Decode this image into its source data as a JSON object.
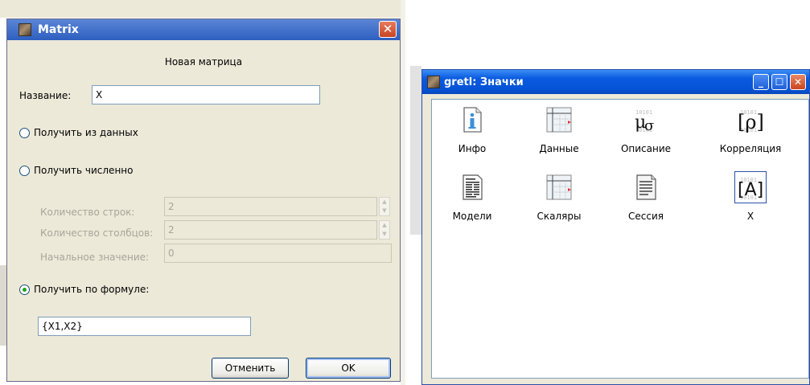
{
  "matrix_dialog": {
    "title": "Matrix",
    "heading": "Новая матрица",
    "name_label": "Название:",
    "name_value": "X",
    "from_data_label": "Получить из данных",
    "numeric_label": "Получить численно",
    "rows_label": "Количество строк:",
    "rows_value": "2",
    "cols_label": "Количество столбцов:",
    "cols_value": "2",
    "init_label": "Начальное значение:",
    "init_value": "0",
    "formula_label": "Получить по формуле:",
    "formula_value": "{X1,X2}",
    "cancel_label": "Отменить",
    "ok_label": "OK",
    "selected_option": "formula"
  },
  "icons_window": {
    "title": "gretl: Значки",
    "items": [
      {
        "label": "Инфо",
        "icon": "info-icon"
      },
      {
        "label": "Данные",
        "icon": "data-table-icon"
      },
      {
        "label": "Описание",
        "icon": "summary-stats-icon"
      },
      {
        "label": "Корреляция",
        "icon": "correlation-icon"
      },
      {
        "label": "Модели",
        "icon": "models-icon"
      },
      {
        "label": "Скаляры",
        "icon": "scalars-table-icon"
      },
      {
        "label": "Сессия",
        "icon": "session-notes-icon"
      },
      {
        "label": "X",
        "icon": "matrix-icon"
      }
    ]
  },
  "colors": {
    "xp_title_blue": "#0553d6",
    "dialog_bg": "#ece9d8",
    "radio_selected": "#21a121"
  }
}
